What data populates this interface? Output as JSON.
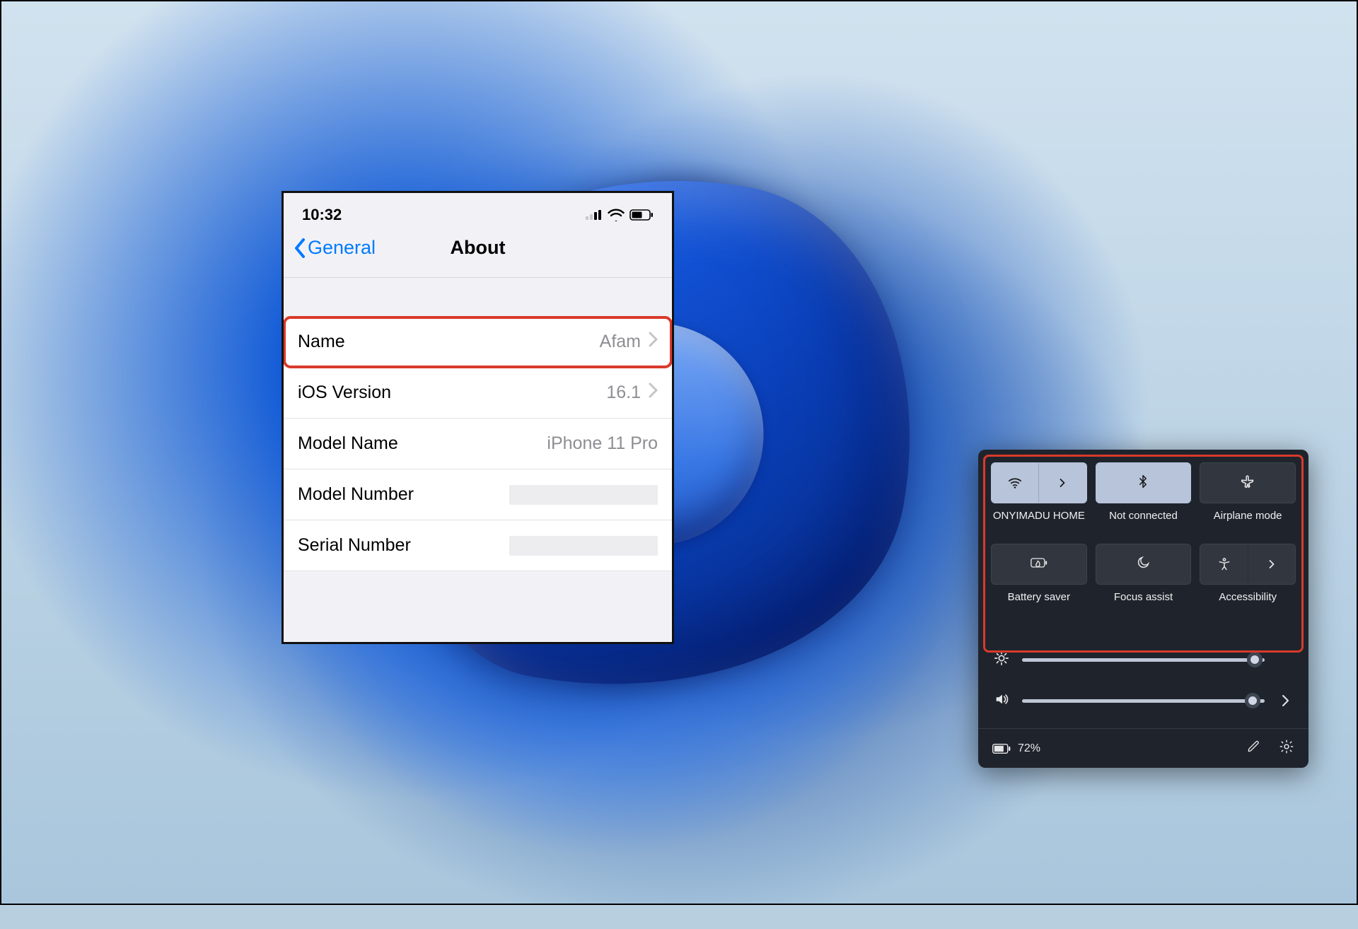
{
  "ios": {
    "time": "10:32",
    "back_label": "General",
    "title": "About",
    "rows": [
      {
        "label": "Name",
        "value": "Afam",
        "chevron": true,
        "highlighted": true
      },
      {
        "label": "iOS Version",
        "value": "16.1",
        "chevron": true,
        "highlighted": false
      },
      {
        "label": "Model Name",
        "value": "iPhone 11 Pro",
        "chevron": false,
        "highlighted": false
      },
      {
        "label": "Model Number",
        "value": "",
        "chevron": false,
        "highlighted": false,
        "redacted": true
      },
      {
        "label": "Serial Number",
        "value": "",
        "chevron": false,
        "highlighted": false,
        "redacted": true
      }
    ]
  },
  "quick_settings": {
    "tiles": [
      {
        "icon": "wifi",
        "label": "ONYIMADU HOME",
        "active": true,
        "split": true
      },
      {
        "icon": "bluetooth",
        "label": "Not connected",
        "active": true,
        "split": false
      },
      {
        "icon": "airplane",
        "label": "Airplane mode",
        "active": false,
        "split": false
      },
      {
        "icon": "battery-saver",
        "label": "Battery saver",
        "active": false,
        "split": false
      },
      {
        "icon": "moon",
        "label": "Focus assist",
        "active": false,
        "split": false
      },
      {
        "icon": "accessibility",
        "label": "Accessibility",
        "active": false,
        "split": true
      }
    ],
    "sliders": {
      "brightness_percent": 96,
      "volume_percent": 95
    },
    "battery_text": "72%"
  }
}
